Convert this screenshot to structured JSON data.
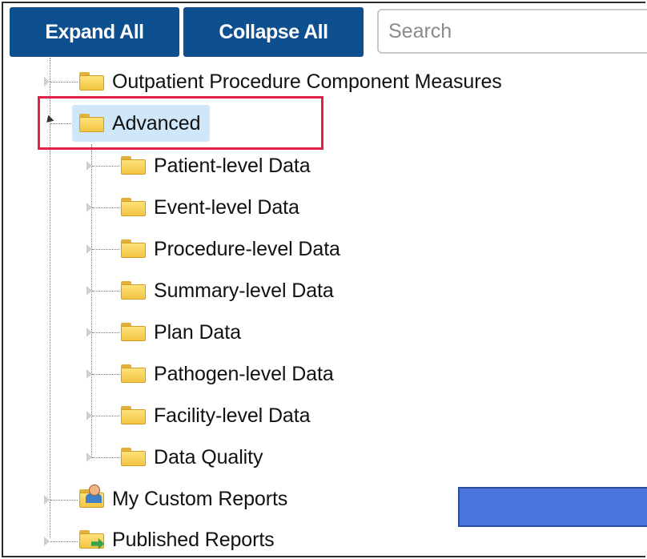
{
  "toolbar": {
    "expand_label": "Expand All",
    "collapse_label": "Collapse All",
    "search_placeholder": "Search"
  },
  "tree": {
    "root_items": [
      {
        "label": "Outpatient Procedure Component Measures",
        "icon": "folder-icon",
        "expanded": false
      },
      {
        "label": "Advanced",
        "icon": "folder-icon",
        "expanded": true,
        "selected": true,
        "children": [
          {
            "label": "Patient-level Data",
            "icon": "folder-icon"
          },
          {
            "label": "Event-level Data",
            "icon": "folder-icon"
          },
          {
            "label": "Procedure-level Data",
            "icon": "folder-icon"
          },
          {
            "label": "Summary-level Data",
            "icon": "folder-icon"
          },
          {
            "label": "Plan Data",
            "icon": "folder-icon"
          },
          {
            "label": "Pathogen-level Data",
            "icon": "folder-icon"
          },
          {
            "label": "Facility-level Data",
            "icon": "folder-icon"
          },
          {
            "label": "Data Quality",
            "icon": "folder-icon"
          }
        ]
      },
      {
        "label": "My Custom Reports",
        "icon": "user-folder-icon",
        "expanded": false
      },
      {
        "label": "Published Reports",
        "icon": "published-folder-icon",
        "expanded": false
      }
    ]
  },
  "colors": {
    "button_bg": "#0e4f8f",
    "selected_bg": "#cfe7f8",
    "highlight_border": "#e0234a",
    "overlay_rect": "#4a75dd"
  }
}
